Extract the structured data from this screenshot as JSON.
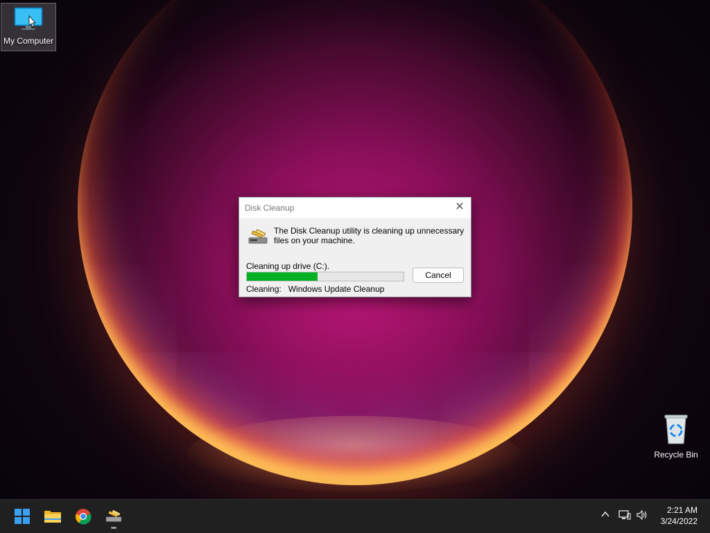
{
  "desktop": {
    "icons": [
      {
        "label": "My Computer",
        "icon": "monitor-icon"
      },
      {
        "label": "Recycle Bin",
        "icon": "recycle-bin-icon"
      }
    ]
  },
  "dialog": {
    "title": "Disk Cleanup",
    "close_glyph": "✕",
    "message": "The Disk Cleanup utility is cleaning up unnecessary files on your machine.",
    "drive_label": "Cleaning up drive  (C:).",
    "progress_percent": 45,
    "cleaning_label": "Cleaning:",
    "cleaning_item": "Windows Update Cleanup",
    "cancel_label": "Cancel"
  },
  "taskbar": {
    "apps": [
      {
        "name": "start",
        "icon": "windows-logo-icon"
      },
      {
        "name": "file-explorer",
        "icon": "folder-icon"
      },
      {
        "name": "chrome",
        "icon": "chrome-icon"
      },
      {
        "name": "disk-cleanup",
        "icon": "disk-cleanup-icon",
        "active": true
      }
    ],
    "tray": {
      "chevron": "^",
      "time": "2:21 AM",
      "date": "3/24/2022"
    }
  },
  "colors": {
    "progress": "#06b025",
    "taskbar": "#202020",
    "accent": "#0078d4"
  }
}
